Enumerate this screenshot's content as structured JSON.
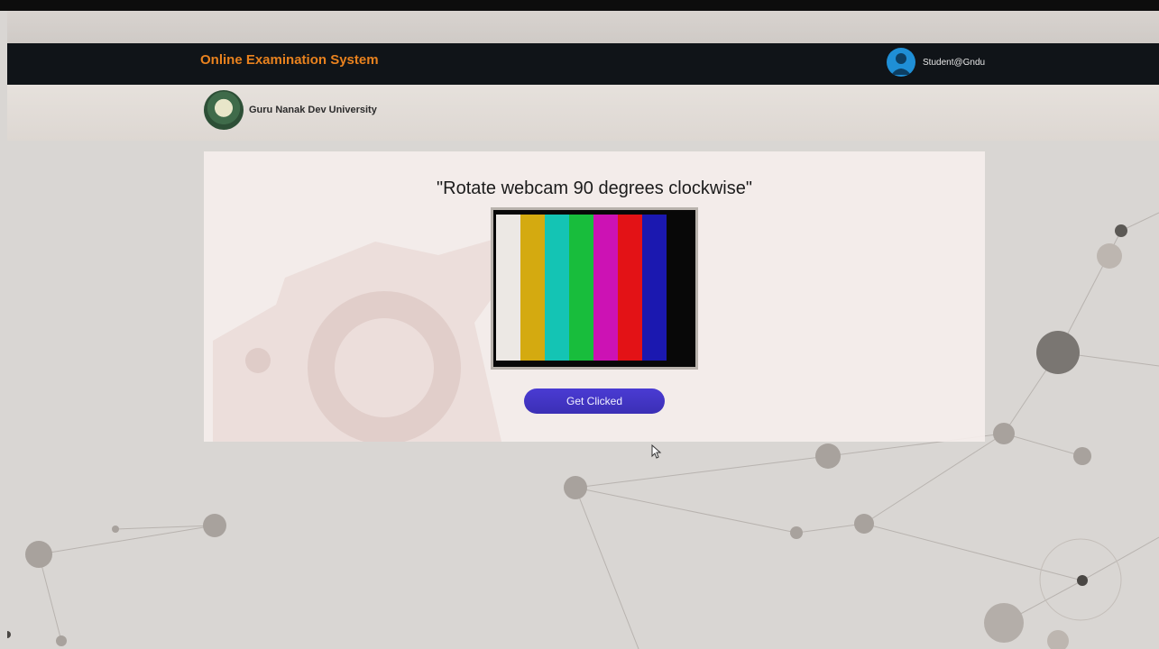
{
  "header": {
    "title": "Online Examination System",
    "user": "Student@Gndu"
  },
  "brand": {
    "university": "Guru Nanak Dev University"
  },
  "main": {
    "instruction": "\"Rotate webcam 90 degrees clockwise\"",
    "button_label": "Get Clicked",
    "color_bars": [
      "#ece8e4",
      "#d4aa10",
      "#14c4b4",
      "#18bd3c",
      "#cc12b4",
      "#e31216",
      "#1b18b0"
    ]
  },
  "colors": {
    "navbar_bg": "#101418",
    "title_accent": "#e9821e",
    "button_bg": "#4a3bd3"
  }
}
